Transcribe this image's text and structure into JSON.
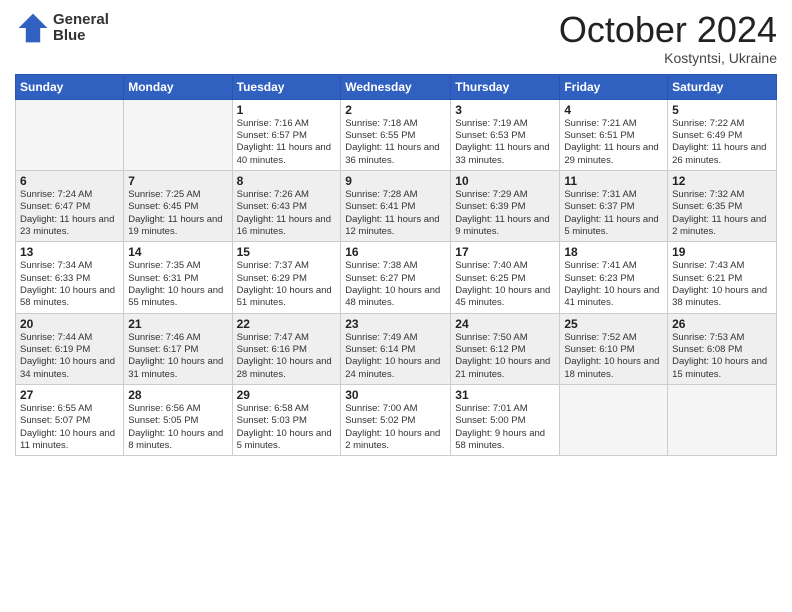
{
  "header": {
    "logo_line1": "General",
    "logo_line2": "Blue",
    "month": "October 2024",
    "location": "Kostyntsi, Ukraine"
  },
  "weekdays": [
    "Sunday",
    "Monday",
    "Tuesday",
    "Wednesday",
    "Thursday",
    "Friday",
    "Saturday"
  ],
  "weeks": [
    [
      {
        "day": "",
        "detail": ""
      },
      {
        "day": "",
        "detail": ""
      },
      {
        "day": "1",
        "detail": "Sunrise: 7:16 AM\nSunset: 6:57 PM\nDaylight: 11 hours and 40 minutes."
      },
      {
        "day": "2",
        "detail": "Sunrise: 7:18 AM\nSunset: 6:55 PM\nDaylight: 11 hours and 36 minutes."
      },
      {
        "day": "3",
        "detail": "Sunrise: 7:19 AM\nSunset: 6:53 PM\nDaylight: 11 hours and 33 minutes."
      },
      {
        "day": "4",
        "detail": "Sunrise: 7:21 AM\nSunset: 6:51 PM\nDaylight: 11 hours and 29 minutes."
      },
      {
        "day": "5",
        "detail": "Sunrise: 7:22 AM\nSunset: 6:49 PM\nDaylight: 11 hours and 26 minutes."
      }
    ],
    [
      {
        "day": "6",
        "detail": "Sunrise: 7:24 AM\nSunset: 6:47 PM\nDaylight: 11 hours and 23 minutes."
      },
      {
        "day": "7",
        "detail": "Sunrise: 7:25 AM\nSunset: 6:45 PM\nDaylight: 11 hours and 19 minutes."
      },
      {
        "day": "8",
        "detail": "Sunrise: 7:26 AM\nSunset: 6:43 PM\nDaylight: 11 hours and 16 minutes."
      },
      {
        "day": "9",
        "detail": "Sunrise: 7:28 AM\nSunset: 6:41 PM\nDaylight: 11 hours and 12 minutes."
      },
      {
        "day": "10",
        "detail": "Sunrise: 7:29 AM\nSunset: 6:39 PM\nDaylight: 11 hours and 9 minutes."
      },
      {
        "day": "11",
        "detail": "Sunrise: 7:31 AM\nSunset: 6:37 PM\nDaylight: 11 hours and 5 minutes."
      },
      {
        "day": "12",
        "detail": "Sunrise: 7:32 AM\nSunset: 6:35 PM\nDaylight: 11 hours and 2 minutes."
      }
    ],
    [
      {
        "day": "13",
        "detail": "Sunrise: 7:34 AM\nSunset: 6:33 PM\nDaylight: 10 hours and 58 minutes."
      },
      {
        "day": "14",
        "detail": "Sunrise: 7:35 AM\nSunset: 6:31 PM\nDaylight: 10 hours and 55 minutes."
      },
      {
        "day": "15",
        "detail": "Sunrise: 7:37 AM\nSunset: 6:29 PM\nDaylight: 10 hours and 51 minutes."
      },
      {
        "day": "16",
        "detail": "Sunrise: 7:38 AM\nSunset: 6:27 PM\nDaylight: 10 hours and 48 minutes."
      },
      {
        "day": "17",
        "detail": "Sunrise: 7:40 AM\nSunset: 6:25 PM\nDaylight: 10 hours and 45 minutes."
      },
      {
        "day": "18",
        "detail": "Sunrise: 7:41 AM\nSunset: 6:23 PM\nDaylight: 10 hours and 41 minutes."
      },
      {
        "day": "19",
        "detail": "Sunrise: 7:43 AM\nSunset: 6:21 PM\nDaylight: 10 hours and 38 minutes."
      }
    ],
    [
      {
        "day": "20",
        "detail": "Sunrise: 7:44 AM\nSunset: 6:19 PM\nDaylight: 10 hours and 34 minutes."
      },
      {
        "day": "21",
        "detail": "Sunrise: 7:46 AM\nSunset: 6:17 PM\nDaylight: 10 hours and 31 minutes."
      },
      {
        "day": "22",
        "detail": "Sunrise: 7:47 AM\nSunset: 6:16 PM\nDaylight: 10 hours and 28 minutes."
      },
      {
        "day": "23",
        "detail": "Sunrise: 7:49 AM\nSunset: 6:14 PM\nDaylight: 10 hours and 24 minutes."
      },
      {
        "day": "24",
        "detail": "Sunrise: 7:50 AM\nSunset: 6:12 PM\nDaylight: 10 hours and 21 minutes."
      },
      {
        "day": "25",
        "detail": "Sunrise: 7:52 AM\nSunset: 6:10 PM\nDaylight: 10 hours and 18 minutes."
      },
      {
        "day": "26",
        "detail": "Sunrise: 7:53 AM\nSunset: 6:08 PM\nDaylight: 10 hours and 15 minutes."
      }
    ],
    [
      {
        "day": "27",
        "detail": "Sunrise: 6:55 AM\nSunset: 5:07 PM\nDaylight: 10 hours and 11 minutes."
      },
      {
        "day": "28",
        "detail": "Sunrise: 6:56 AM\nSunset: 5:05 PM\nDaylight: 10 hours and 8 minutes."
      },
      {
        "day": "29",
        "detail": "Sunrise: 6:58 AM\nSunset: 5:03 PM\nDaylight: 10 hours and 5 minutes."
      },
      {
        "day": "30",
        "detail": "Sunrise: 7:00 AM\nSunset: 5:02 PM\nDaylight: 10 hours and 2 minutes."
      },
      {
        "day": "31",
        "detail": "Sunrise: 7:01 AM\nSunset: 5:00 PM\nDaylight: 9 hours and 58 minutes."
      },
      {
        "day": "",
        "detail": ""
      },
      {
        "day": "",
        "detail": ""
      }
    ]
  ]
}
